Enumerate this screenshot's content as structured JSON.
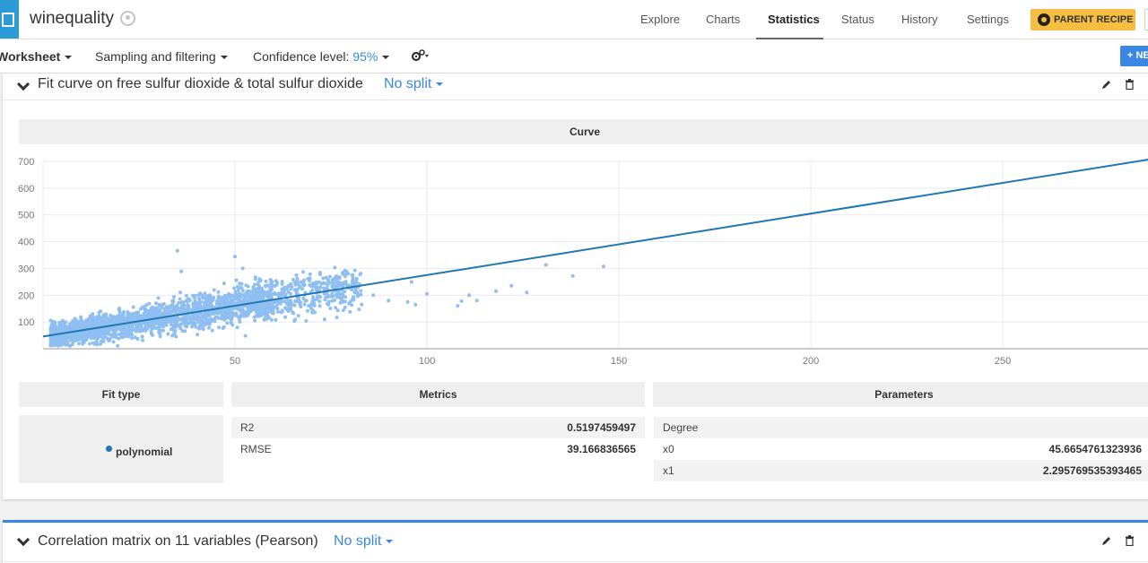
{
  "app": {
    "title": "winequality"
  },
  "nav": {
    "tabs": [
      "Explore",
      "Charts",
      "Statistics",
      "Status",
      "History",
      "Settings"
    ],
    "active": "Statistics",
    "parent_recipe_label": "PARENT RECIPE"
  },
  "toolbar": {
    "worksheet_label": "Worksheet",
    "sampling_label": "Sampling and filtering",
    "confidence_label": "Confidence level:",
    "confidence_value": "95%",
    "new_label": "+ NE"
  },
  "card1": {
    "title": "Fit curve on free sulfur dioxide & total sulfur dioxide",
    "split_label": "No split",
    "curve_header": "Curve",
    "fit_type_header": "Fit type",
    "metrics_header": "Metrics",
    "parameters_header": "Parameters",
    "fit_type": "polynomial",
    "metrics": [
      {
        "key": "R2",
        "value": "0.5197459497"
      },
      {
        "key": "RMSE",
        "value": "39.166836565"
      }
    ],
    "parameters": [
      {
        "key": "Degree",
        "value": ""
      },
      {
        "key": "x0",
        "value": "45.6654761323936"
      },
      {
        "key": "x1",
        "value": "2.295769535393465"
      }
    ]
  },
  "card2": {
    "title": "Correlation matrix on 11 variables (Pearson)",
    "split_label": "No split"
  },
  "chart_data": {
    "type": "scatter",
    "xlim": [
      0,
      289
    ],
    "ylim": [
      0,
      700
    ],
    "x_ticks": [
      50,
      100,
      150,
      200,
      250
    ],
    "y_ticks": [
      100,
      200,
      300,
      400,
      500,
      600,
      700
    ],
    "grid": true,
    "point_color": "#8fbff0",
    "line_color": "#1f77b4",
    "fit_line": {
      "intercept": 45.6654761323936,
      "slope": 2.295769535393465
    },
    "outliers": [
      [
        35,
        366
      ],
      [
        50,
        344
      ],
      [
        52,
        300
      ],
      [
        36,
        289
      ],
      [
        76,
        303
      ],
      [
        66,
        275
      ],
      [
        96,
        250
      ],
      [
        100,
        205
      ],
      [
        109,
        178
      ],
      [
        111,
        200
      ],
      [
        108,
        160
      ],
      [
        118,
        215
      ],
      [
        126,
        210
      ],
      [
        131,
        313
      ],
      [
        138,
        272
      ],
      [
        146,
        307
      ],
      [
        122,
        235
      ],
      [
        113,
        180
      ],
      [
        90,
        180
      ],
      [
        97,
        165
      ],
      [
        95,
        175
      ],
      [
        86,
        200
      ],
      [
        82,
        230
      ],
      [
        80,
        175
      ]
    ]
  }
}
